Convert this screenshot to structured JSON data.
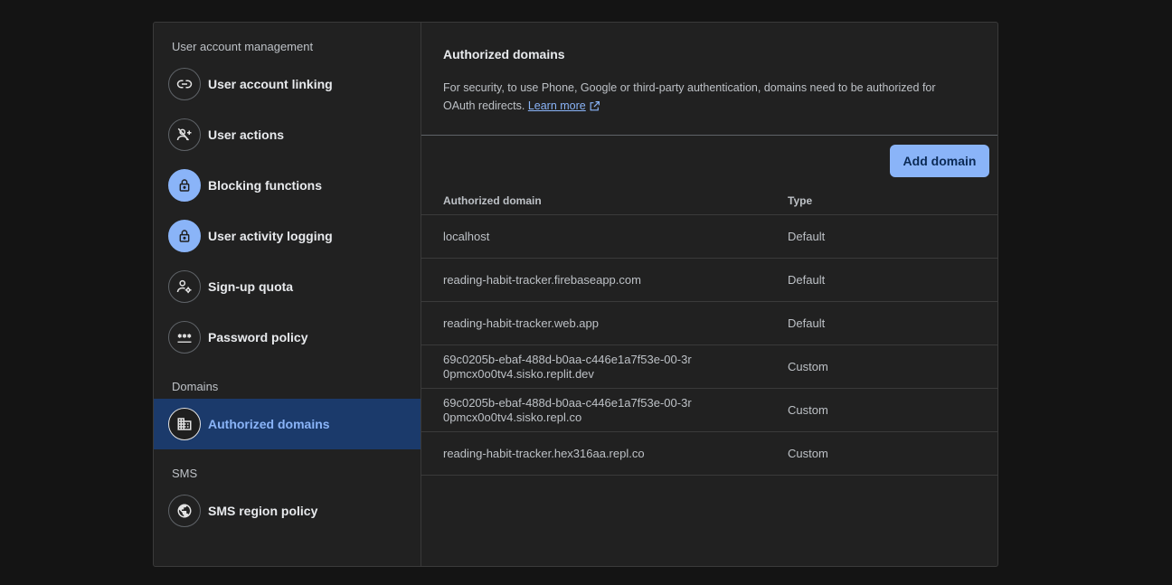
{
  "sidebar": {
    "sections": {
      "user_account_management": "User account management",
      "domains": "Domains",
      "sms": "SMS"
    },
    "items": [
      {
        "label": "User account linking",
        "icon": "link-icon"
      },
      {
        "label": "User actions",
        "icon": "person-add-off-icon"
      },
      {
        "label": "Blocking functions",
        "icon": "lock-icon"
      },
      {
        "label": "User activity logging",
        "icon": "lock-icon"
      },
      {
        "label": "Sign-up quota",
        "icon": "person-settings-icon"
      },
      {
        "label": "Password policy",
        "icon": "password-icon"
      },
      {
        "label": "Authorized domains",
        "icon": "domain-icon",
        "active": true
      },
      {
        "label": "SMS region policy",
        "icon": "globe-icon"
      }
    ]
  },
  "main": {
    "title": "Authorized domains",
    "description": "For security, to use Phone, Google or third-party authentication, domains need to be authorized for OAuth redirects.",
    "learn_more": "Learn more",
    "add_button": "Add domain",
    "table": {
      "headers": {
        "domain": "Authorized domain",
        "type": "Type"
      },
      "rows": [
        {
          "domain": "localhost",
          "type": "Default"
        },
        {
          "domain": "reading-habit-tracker.firebaseapp.com",
          "type": "Default"
        },
        {
          "domain": "reading-habit-tracker.web.app",
          "type": "Default"
        },
        {
          "domain": "69c0205b-ebaf-488d-b0aa-c446e1a7f53e-00-3r0pmcx0o0tv4.sisko.replit.dev",
          "type": "Custom"
        },
        {
          "domain": "69c0205b-ebaf-488d-b0aa-c446e1a7f53e-00-3r0pmcx0o0tv4.sisko.repl.co",
          "type": "Custom"
        },
        {
          "domain": "reading-habit-tracker.hex316aa.repl.co",
          "type": "Custom"
        }
      ]
    }
  },
  "colors": {
    "accent": "#8ab4f8",
    "active_bg": "#1b3a6b",
    "card_bg": "#212121",
    "page_bg": "#141414"
  }
}
